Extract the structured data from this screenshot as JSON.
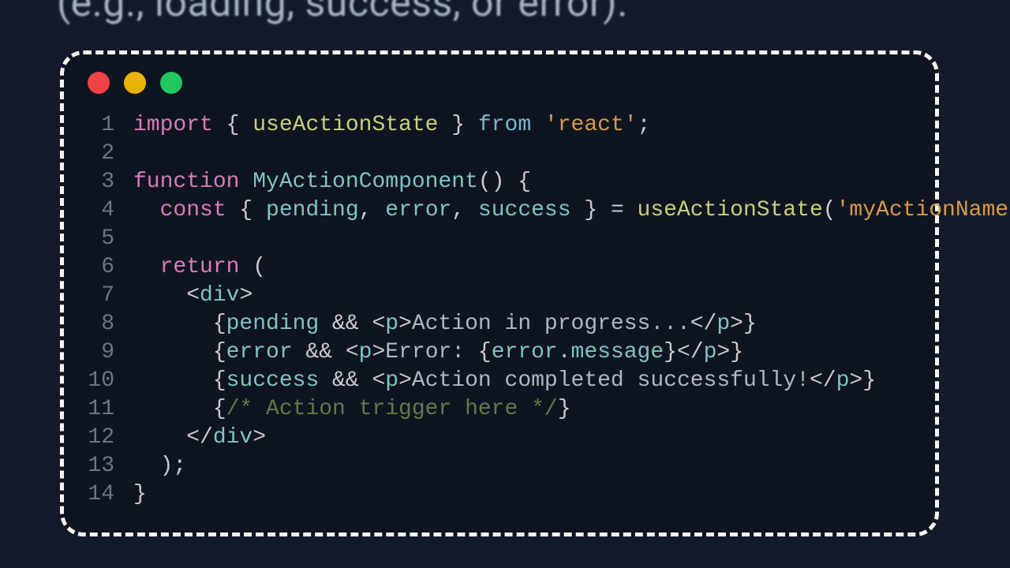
{
  "heading_fragment": "(e.g., loading, success, or error).",
  "traffic_light_colors": {
    "close": "#ef4444",
    "minimize": "#eab308",
    "zoom": "#22c55e"
  },
  "code": {
    "lines": [
      {
        "n": "1",
        "tokens": [
          {
            "c": "kw",
            "t": "import"
          },
          {
            "c": "pun",
            "t": " { "
          },
          {
            "c": "fn",
            "t": "useActionState"
          },
          {
            "c": "pun",
            "t": " } "
          },
          {
            "c": "op",
            "t": "from"
          },
          {
            "c": "pun",
            "t": " "
          },
          {
            "c": "str",
            "t": "'react'"
          },
          {
            "c": "pun",
            "t": ";"
          }
        ]
      },
      {
        "n": "2",
        "tokens": []
      },
      {
        "n": "3",
        "tokens": [
          {
            "c": "kw",
            "t": "function"
          },
          {
            "c": "pun",
            "t": " "
          },
          {
            "c": "name",
            "t": "MyActionComponent"
          },
          {
            "c": "pun",
            "t": "() {"
          }
        ]
      },
      {
        "n": "4",
        "tokens": [
          {
            "c": "pun",
            "t": "  "
          },
          {
            "c": "kw",
            "t": "const"
          },
          {
            "c": "pun",
            "t": " { "
          },
          {
            "c": "name",
            "t": "pending"
          },
          {
            "c": "pun",
            "t": ", "
          },
          {
            "c": "name",
            "t": "error"
          },
          {
            "c": "pun",
            "t": ", "
          },
          {
            "c": "name",
            "t": "success"
          },
          {
            "c": "pun",
            "t": " } = "
          },
          {
            "c": "fn",
            "t": "useActionState"
          },
          {
            "c": "pun",
            "t": "("
          },
          {
            "c": "str",
            "t": "'myActionName'"
          },
          {
            "c": "pun",
            "t": ");"
          }
        ]
      },
      {
        "n": "5",
        "tokens": []
      },
      {
        "n": "6",
        "tokens": [
          {
            "c": "pun",
            "t": "  "
          },
          {
            "c": "kw",
            "t": "return"
          },
          {
            "c": "pun",
            "t": " ("
          }
        ]
      },
      {
        "n": "7",
        "tokens": [
          {
            "c": "pun",
            "t": "    <"
          },
          {
            "c": "name",
            "t": "div"
          },
          {
            "c": "pun",
            "t": ">"
          }
        ]
      },
      {
        "n": "8",
        "tokens": [
          {
            "c": "pun",
            "t": "      {"
          },
          {
            "c": "name",
            "t": "pending"
          },
          {
            "c": "pun",
            "t": " && <"
          },
          {
            "c": "name",
            "t": "p"
          },
          {
            "c": "pun",
            "t": ">"
          },
          {
            "c": "html",
            "t": "Action in progress..."
          },
          {
            "c": "pun",
            "t": "</"
          },
          {
            "c": "name",
            "t": "p"
          },
          {
            "c": "pun",
            "t": ">}"
          }
        ]
      },
      {
        "n": "9",
        "tokens": [
          {
            "c": "pun",
            "t": "      {"
          },
          {
            "c": "name",
            "t": "error"
          },
          {
            "c": "pun",
            "t": " && <"
          },
          {
            "c": "name",
            "t": "p"
          },
          {
            "c": "pun",
            "t": ">"
          },
          {
            "c": "html",
            "t": "Error: "
          },
          {
            "c": "pun",
            "t": "{"
          },
          {
            "c": "name",
            "t": "error"
          },
          {
            "c": "pun",
            "t": "."
          },
          {
            "c": "name",
            "t": "message"
          },
          {
            "c": "pun",
            "t": "}</"
          },
          {
            "c": "name",
            "t": "p"
          },
          {
            "c": "pun",
            "t": ">}"
          }
        ]
      },
      {
        "n": "10",
        "tokens": [
          {
            "c": "pun",
            "t": "      {"
          },
          {
            "c": "name",
            "t": "success"
          },
          {
            "c": "pun",
            "t": " && <"
          },
          {
            "c": "name",
            "t": "p"
          },
          {
            "c": "pun",
            "t": ">"
          },
          {
            "c": "html",
            "t": "Action completed successfully!"
          },
          {
            "c": "pun",
            "t": "</"
          },
          {
            "c": "name",
            "t": "p"
          },
          {
            "c": "pun",
            "t": ">}"
          }
        ]
      },
      {
        "n": "11",
        "tokens": [
          {
            "c": "pun",
            "t": "      {"
          },
          {
            "c": "cmt",
            "t": "/* Action trigger here */"
          },
          {
            "c": "pun",
            "t": "}"
          }
        ]
      },
      {
        "n": "12",
        "tokens": [
          {
            "c": "pun",
            "t": "    </"
          },
          {
            "c": "name",
            "t": "div"
          },
          {
            "c": "pun",
            "t": ">"
          }
        ]
      },
      {
        "n": "13",
        "tokens": [
          {
            "c": "pun",
            "t": "  );"
          }
        ]
      },
      {
        "n": "14",
        "tokens": [
          {
            "c": "pun",
            "t": "}"
          }
        ]
      }
    ]
  }
}
